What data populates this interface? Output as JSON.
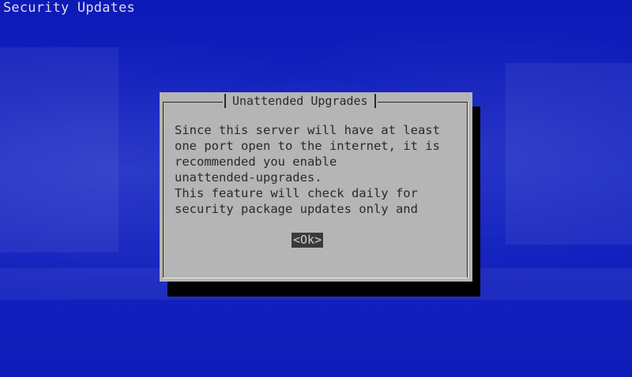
{
  "screen": {
    "title": "Security Updates"
  },
  "dialog": {
    "title": "Unattended Upgrades",
    "lines": [
      "Since this server will have at least",
      "one port open to the internet, it is",
      "recommended you enable",
      "unattended-upgrades.",
      "This feature will check daily for",
      "security package updates only and"
    ],
    "ok_label": "<Ok>"
  },
  "colors": {
    "background": "#0f1bbd",
    "dialog": "#b5b5b5",
    "shadow": "#000000",
    "button_bg": "#3a3a3a",
    "text": "#2a2a2a",
    "title_text": "#dcdce8"
  }
}
